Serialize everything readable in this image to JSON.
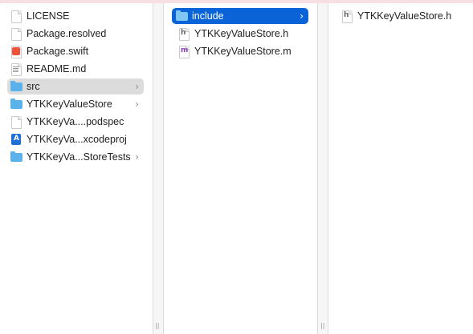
{
  "columns": [
    {
      "items": [
        {
          "label": "LICENSE",
          "icon": "document-icon"
        },
        {
          "label": "Package.resolved",
          "icon": "document-icon"
        },
        {
          "label": "Package.swift",
          "icon": "swift-file-icon"
        },
        {
          "label": "README.md",
          "icon": "markdown-file-icon"
        },
        {
          "label": "src",
          "icon": "folder-icon",
          "selected": "inactive"
        },
        {
          "label": "YTKKeyValueStore",
          "icon": "folder-icon"
        },
        {
          "label": "YTKKeyVa....podspec",
          "icon": "document-icon"
        },
        {
          "label": "YTKKeyVa...xcodeproj",
          "icon": "xcodeproj-icon"
        },
        {
          "label": "YTKKeyVa...StoreTests",
          "icon": "folder-icon"
        }
      ]
    },
    {
      "items": [
        {
          "label": "include",
          "icon": "folder-icon",
          "selected": "active"
        },
        {
          "label": "YTKKeyValueStore.h",
          "icon": "header-file-icon",
          "letter": "h"
        },
        {
          "label": "YTKKeyValueStore.m",
          "icon": "objc-file-icon",
          "letter": "m"
        }
      ]
    },
    {
      "items": [
        {
          "label": "YTKKeyValueStore.h",
          "icon": "header-alias-icon",
          "letter": "h"
        }
      ]
    }
  ],
  "colors": {
    "selection_active": "#0a64d8",
    "selection_inactive": "#dcdcdc",
    "folder": "#5bb2ea"
  },
  "resize_grip": "||"
}
